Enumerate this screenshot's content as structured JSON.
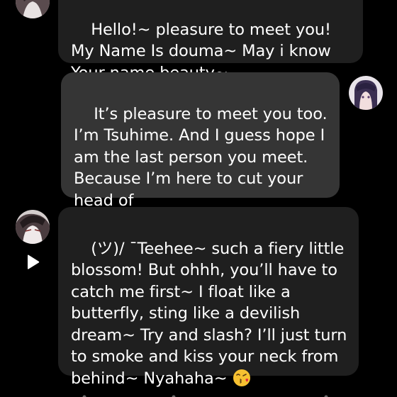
{
  "chat": {
    "messages": [
      {
        "sender": "bot",
        "text": "Hello!~ pleasure to meet you! My Name Is douma~ May i know Your name beauty~"
      },
      {
        "sender": "user",
        "text": "It’s pleasure to meet you too. I’m Tsuhime. And I guess hope I am the last person you meet. Because I’m here to cut your head of"
      },
      {
        "sender": "bot",
        "text": "(ツ)/ ¯Teehee~ such a fiery little blossom! But ohhh, you’ll have to catch me first~ I float like a butterfly, sting like a devilish dream~ Try and slash? I’ll just turn to smoke and kiss your neck from behind~ Nyahaha~ ",
        "trailing_emoji": "face-blowing-a-kiss-emoji"
      }
    ],
    "icons": {
      "play": "play-icon",
      "bot_avatar": "bot-avatar",
      "user_avatar": "user-avatar"
    },
    "colors": {
      "background": "#000000",
      "bot_bubble": "#1f1f1f",
      "user_bubble": "#353535",
      "text": "#ffffff"
    }
  }
}
